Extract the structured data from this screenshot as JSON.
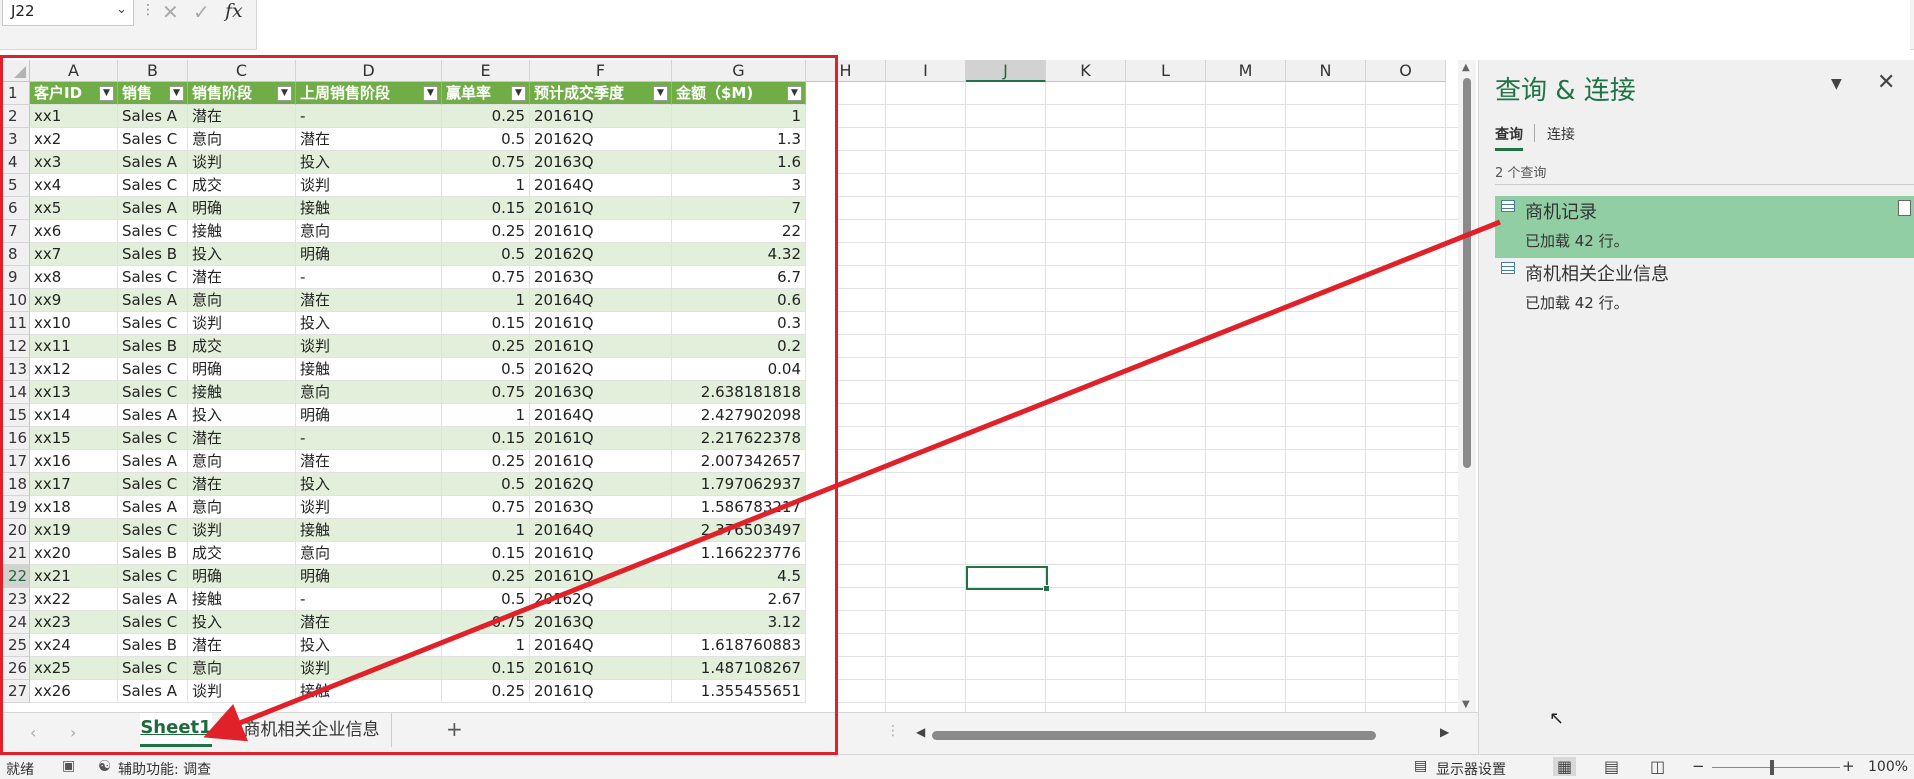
{
  "formula_bar": {
    "name_box": "J22",
    "fx": "fx"
  },
  "columns": [
    {
      "letter": "A",
      "header": "客户ID"
    },
    {
      "letter": "B",
      "header": "销售"
    },
    {
      "letter": "C",
      "header": "销售阶段"
    },
    {
      "letter": "D",
      "header": "上周销售阶段"
    },
    {
      "letter": "E",
      "header": "赢单率"
    },
    {
      "letter": "F",
      "header": "预计成交季度"
    },
    {
      "letter": "G",
      "header": "金额（$M)"
    }
  ],
  "extra_columns": [
    "H",
    "I",
    "J",
    "K",
    "L",
    "M",
    "N",
    "O"
  ],
  "rows": [
    [
      "xx1",
      "Sales A",
      "潜在",
      "-",
      "0.25",
      "20161Q",
      "1"
    ],
    [
      "xx2",
      "Sales C",
      "意向",
      "潜在",
      "0.5",
      "20162Q",
      "1.3"
    ],
    [
      "xx3",
      "Sales A",
      "谈判",
      "投入",
      "0.75",
      "20163Q",
      "1.6"
    ],
    [
      "xx4",
      "Sales C",
      "成交",
      "谈判",
      "1",
      "20164Q",
      "3"
    ],
    [
      "xx5",
      "Sales A",
      "明确",
      "接触",
      "0.15",
      "20161Q",
      "7"
    ],
    [
      "xx6",
      "Sales C",
      "接触",
      "意向",
      "0.25",
      "20161Q",
      "22"
    ],
    [
      "xx7",
      "Sales B",
      "投入",
      "明确",
      "0.5",
      "20162Q",
      "4.32"
    ],
    [
      "xx8",
      "Sales C",
      "潜在",
      "-",
      "0.75",
      "20163Q",
      "6.7"
    ],
    [
      "xx9",
      "Sales A",
      "意向",
      "潜在",
      "1",
      "20164Q",
      "0.6"
    ],
    [
      "xx10",
      "Sales C",
      "谈判",
      "投入",
      "0.15",
      "20161Q",
      "0.3"
    ],
    [
      "xx11",
      "Sales B",
      "成交",
      "谈判",
      "0.25",
      "20161Q",
      "0.2"
    ],
    [
      "xx12",
      "Sales C",
      "明确",
      "接触",
      "0.5",
      "20162Q",
      "0.04"
    ],
    [
      "xx13",
      "Sales C",
      "接触",
      "意向",
      "0.75",
      "20163Q",
      "2.638181818"
    ],
    [
      "xx14",
      "Sales A",
      "投入",
      "明确",
      "1",
      "20164Q",
      "2.427902098"
    ],
    [
      "xx15",
      "Sales C",
      "潜在",
      "-",
      "0.15",
      "20161Q",
      "2.217622378"
    ],
    [
      "xx16",
      "Sales A",
      "意向",
      "潜在",
      "0.25",
      "20161Q",
      "2.007342657"
    ],
    [
      "xx17",
      "Sales C",
      "潜在",
      "投入",
      "0.5",
      "20162Q",
      "1.797062937"
    ],
    [
      "xx18",
      "Sales A",
      "意向",
      "谈判",
      "0.75",
      "20163Q",
      "1.586783217"
    ],
    [
      "xx19",
      "Sales C",
      "谈判",
      "接触",
      "1",
      "20164Q",
      "2.376503497"
    ],
    [
      "xx20",
      "Sales B",
      "成交",
      "意向",
      "0.15",
      "20161Q",
      "1.166223776"
    ],
    [
      "xx21",
      "Sales C",
      "明确",
      "明确",
      "0.25",
      "20161Q",
      "4.5"
    ],
    [
      "xx22",
      "Sales A",
      "接触",
      "-",
      "0.5",
      "20162Q",
      "2.67"
    ],
    [
      "xx23",
      "Sales C",
      "投入",
      "潜在",
      "0.75",
      "20163Q",
      "3.12"
    ],
    [
      "xx24",
      "Sales B",
      "潜在",
      "投入",
      "1",
      "20164Q",
      "1.618760883"
    ],
    [
      "xx25",
      "Sales C",
      "意向",
      "谈判",
      "0.15",
      "20161Q",
      "1.487108267"
    ],
    [
      "xx26",
      "Sales A",
      "谈判",
      "接触",
      "0.25",
      "20161Q",
      "1.355455651"
    ]
  ],
  "selected_cell": "J22",
  "sheet_tabs": [
    {
      "label": "Sheet1",
      "active": true
    },
    {
      "label": "商机相关企业信息",
      "active": false
    }
  ],
  "add_sheet": "+",
  "status_bar": {
    "ready": "就绪",
    "accessibility": "辅助功能: 调查",
    "display_settings": "显示器设置",
    "zoom": "100%",
    "zoom_minus": "−",
    "zoom_plus": "+"
  },
  "queries_pane": {
    "title": "查询 & 连接",
    "tab_queries": "查询",
    "tab_connections": "连接",
    "count": "2 个查询",
    "items": [
      {
        "name": "商机记录",
        "rows": "已加载 42 行。",
        "active": true
      },
      {
        "name": "商机相关企业信息",
        "rows": "已加载 42 行。",
        "active": false
      }
    ]
  },
  "colors": {
    "accent": "#217346",
    "table_header": "#70ad47",
    "table_band": "#e2efda",
    "annotation_red": "#e1212a"
  }
}
